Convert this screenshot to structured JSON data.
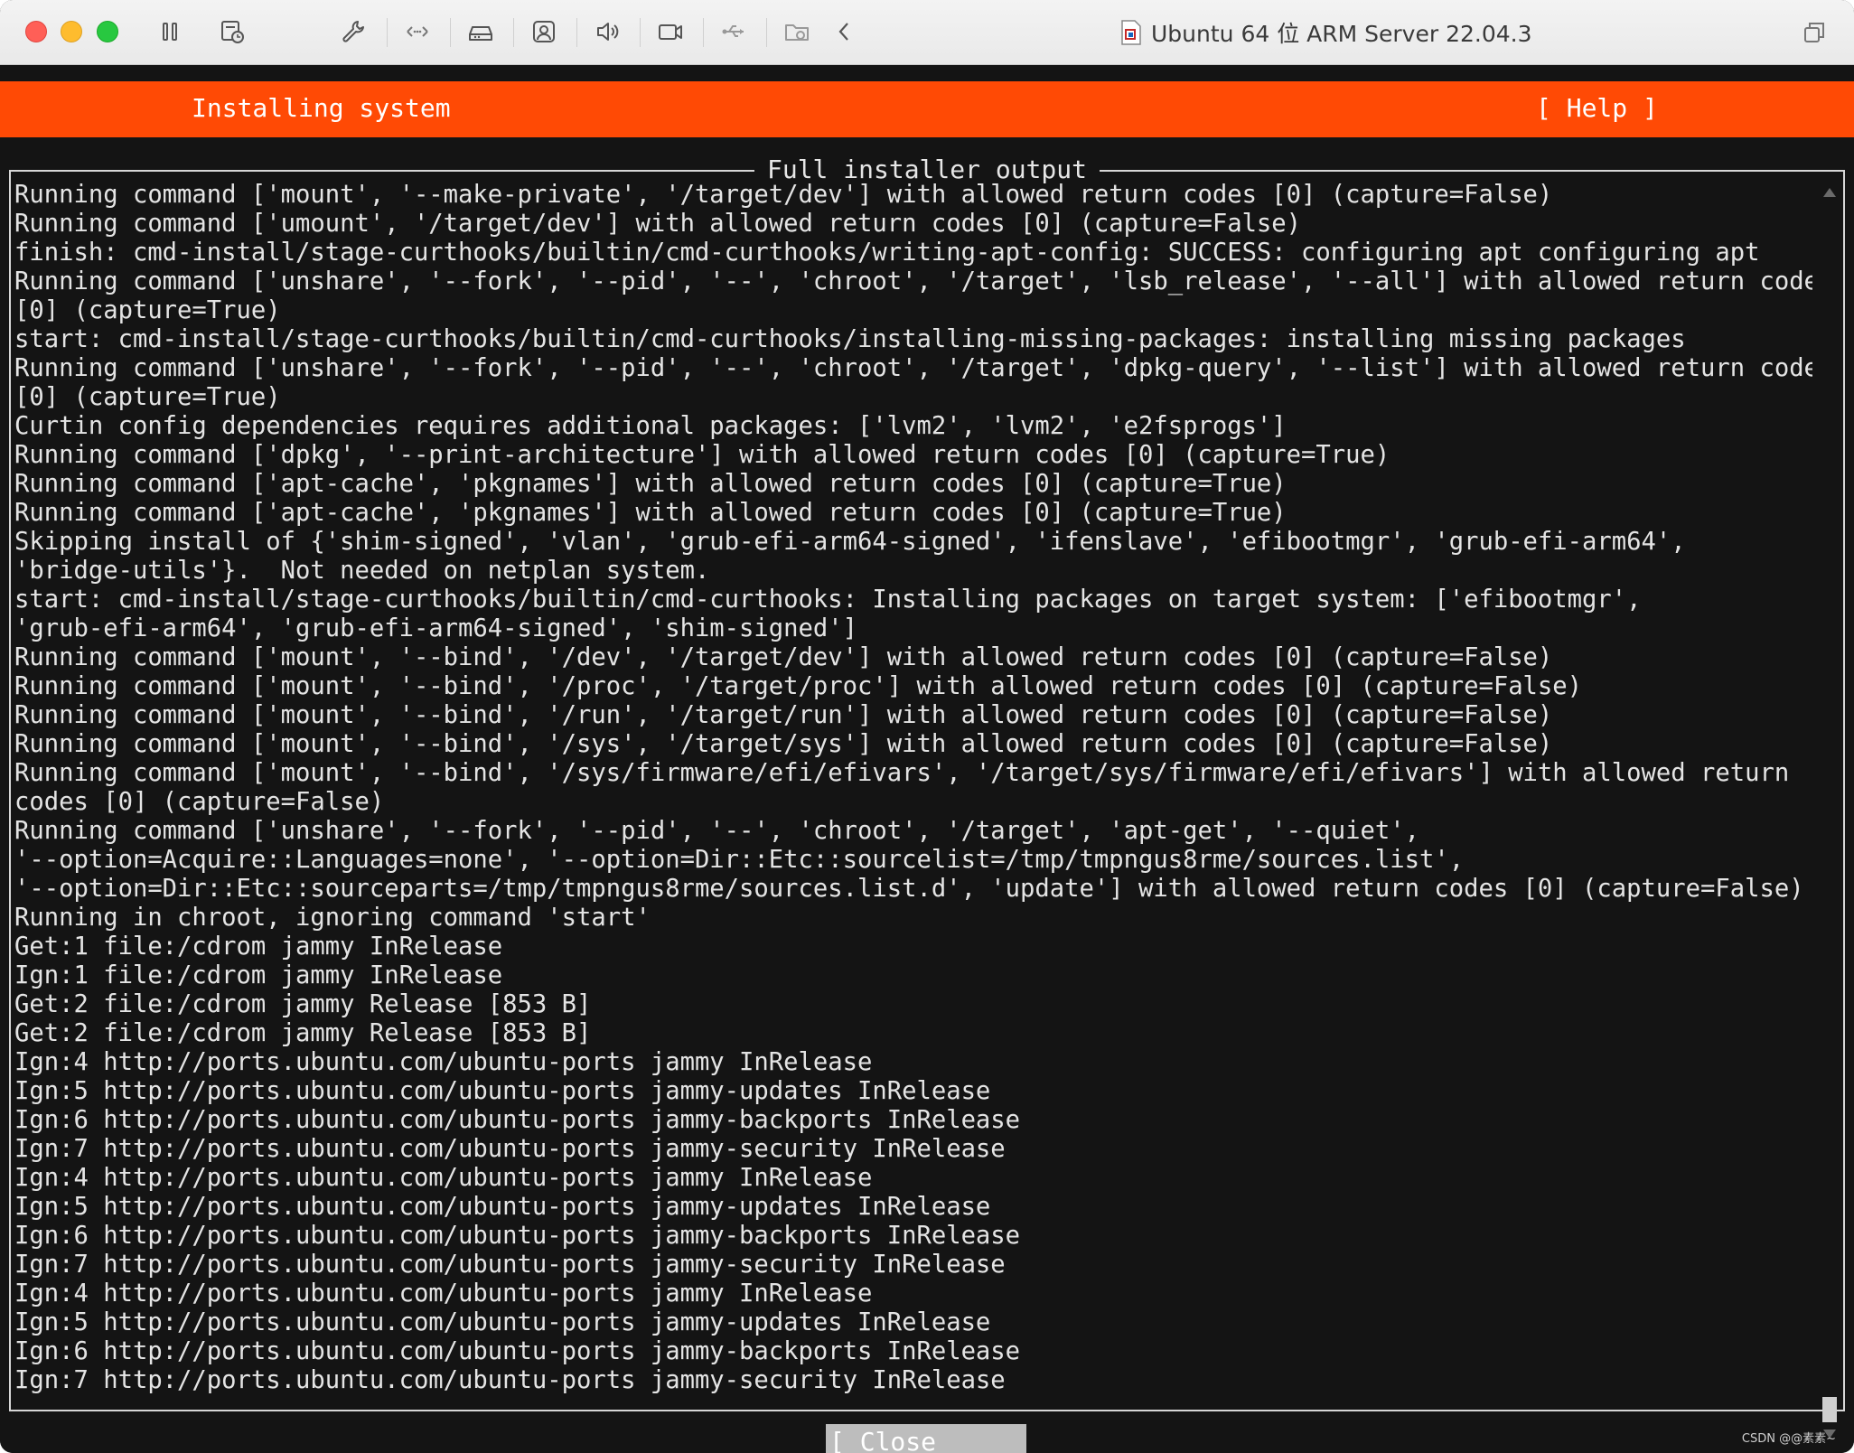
{
  "window": {
    "title": "Ubuntu 64 位 ARM Server 22.04.3",
    "toolbar_icons": [
      "sidebar-toggle-icon",
      "snapshot-icon",
      "settings-wrench-icon",
      "network-arrows-icon",
      "hard-disk-icon",
      "camera-webcam-icon",
      "sound-icon",
      "video-camera-icon",
      "usb-icon",
      "shared-folder-icon",
      "chevron-left-icon"
    ],
    "colors": {
      "close": "#ff5f57",
      "minimize": "#febc2e",
      "zoom": "#28c840"
    }
  },
  "installer": {
    "header_title": "Installing system",
    "help_label": "[ Help ]",
    "panel_title": "Full installer output",
    "close_label": "[ Close      ]",
    "accent_color": "#ff4a05",
    "log_lines": [
      "Running command ['mount', '--make-private', '/target/dev'] with allowed return codes [0] (capture=False)",
      "Running command ['umount', '/target/dev'] with allowed return codes [0] (capture=False)",
      "finish: cmd-install/stage-curthooks/builtin/cmd-curthooks/writing-apt-config: SUCCESS: configuring apt configuring apt",
      "Running command ['unshare', '--fork', '--pid', '--', 'chroot', '/target', 'lsb_release', '--all'] with allowed return codes",
      "[0] (capture=True)",
      "start: cmd-install/stage-curthooks/builtin/cmd-curthooks/installing-missing-packages: installing missing packages",
      "Running command ['unshare', '--fork', '--pid', '--', 'chroot', '/target', 'dpkg-query', '--list'] with allowed return codes",
      "[0] (capture=True)",
      "Curtin config dependencies requires additional packages: ['lvm2', 'lvm2', 'e2fsprogs']",
      "Running command ['dpkg', '--print-architecture'] with allowed return codes [0] (capture=True)",
      "Running command ['apt-cache', 'pkgnames'] with allowed return codes [0] (capture=True)",
      "Running command ['apt-cache', 'pkgnames'] with allowed return codes [0] (capture=True)",
      "Skipping install of {'shim-signed', 'vlan', 'grub-efi-arm64-signed', 'ifenslave', 'efibootmgr', 'grub-efi-arm64',",
      "'bridge-utils'}.  Not needed on netplan system.",
      "start: cmd-install/stage-curthooks/builtin/cmd-curthooks: Installing packages on target system: ['efibootmgr',",
      "'grub-efi-arm64', 'grub-efi-arm64-signed', 'shim-signed']",
      "Running command ['mount', '--bind', '/dev', '/target/dev'] with allowed return codes [0] (capture=False)",
      "Running command ['mount', '--bind', '/proc', '/target/proc'] with allowed return codes [0] (capture=False)",
      "Running command ['mount', '--bind', '/run', '/target/run'] with allowed return codes [0] (capture=False)",
      "Running command ['mount', '--bind', '/sys', '/target/sys'] with allowed return codes [0] (capture=False)",
      "Running command ['mount', '--bind', '/sys/firmware/efi/efivars', '/target/sys/firmware/efi/efivars'] with allowed return",
      "codes [0] (capture=False)",
      "Running command ['unshare', '--fork', '--pid', '--', 'chroot', '/target', 'apt-get', '--quiet',",
      "'--option=Acquire::Languages=none', '--option=Dir::Etc::sourcelist=/tmp/tmpngus8rme/sources.list',",
      "'--option=Dir::Etc::sourceparts=/tmp/tmpngus8rme/sources.list.d', 'update'] with allowed return codes [0] (capture=False)",
      "Running in chroot, ignoring command 'start'",
      "Get:1 file:/cdrom jammy InRelease",
      "Ign:1 file:/cdrom jammy InRelease",
      "Get:2 file:/cdrom jammy Release [853 B]",
      "Get:2 file:/cdrom jammy Release [853 B]",
      "Ign:4 http://ports.ubuntu.com/ubuntu-ports jammy InRelease",
      "Ign:5 http://ports.ubuntu.com/ubuntu-ports jammy-updates InRelease",
      "Ign:6 http://ports.ubuntu.com/ubuntu-ports jammy-backports InRelease",
      "Ign:7 http://ports.ubuntu.com/ubuntu-ports jammy-security InRelease",
      "Ign:4 http://ports.ubuntu.com/ubuntu-ports jammy InRelease",
      "Ign:5 http://ports.ubuntu.com/ubuntu-ports jammy-updates InRelease",
      "Ign:6 http://ports.ubuntu.com/ubuntu-ports jammy-backports InRelease",
      "Ign:7 http://ports.ubuntu.com/ubuntu-ports jammy-security InRelease",
      "Ign:4 http://ports.ubuntu.com/ubuntu-ports jammy InRelease",
      "Ign:5 http://ports.ubuntu.com/ubuntu-ports jammy-updates InRelease",
      "Ign:6 http://ports.ubuntu.com/ubuntu-ports jammy-backports InRelease",
      "Ign:7 http://ports.ubuntu.com/ubuntu-ports jammy-security InRelease"
    ]
  },
  "watermark": "CSDN @@素素~"
}
